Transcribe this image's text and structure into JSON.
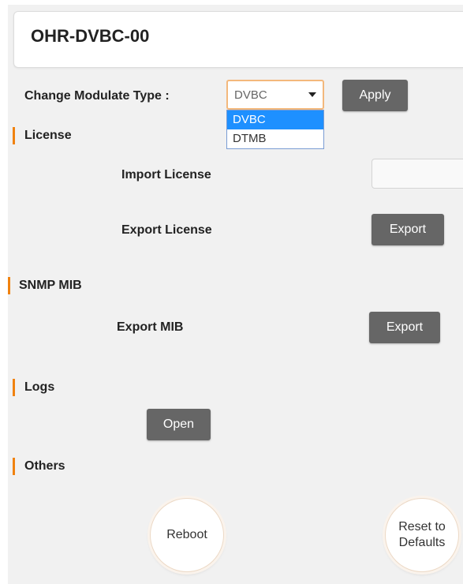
{
  "header": {
    "title": "OHR-DVBC-00"
  },
  "modulate": {
    "label": "Change Modulate Type :",
    "selected": "DVBC",
    "options": [
      "DVBC",
      "DTMB"
    ],
    "apply_label": "Apply"
  },
  "license": {
    "heading": "License",
    "import_label": "Import License",
    "export_label": "Export License",
    "export_button": "Export"
  },
  "snmp": {
    "heading": "SNMP MIB",
    "export_label": "Export MIB",
    "export_button": "Export"
  },
  "logs": {
    "heading": "Logs",
    "open_button": "Open"
  },
  "others": {
    "heading": "Others",
    "reboot_button": "Reboot",
    "reset_button": "Reset to Defaults"
  },
  "colors": {
    "accent": "#f0820f",
    "button": "#666666",
    "selected_option": "#1e90ff"
  }
}
